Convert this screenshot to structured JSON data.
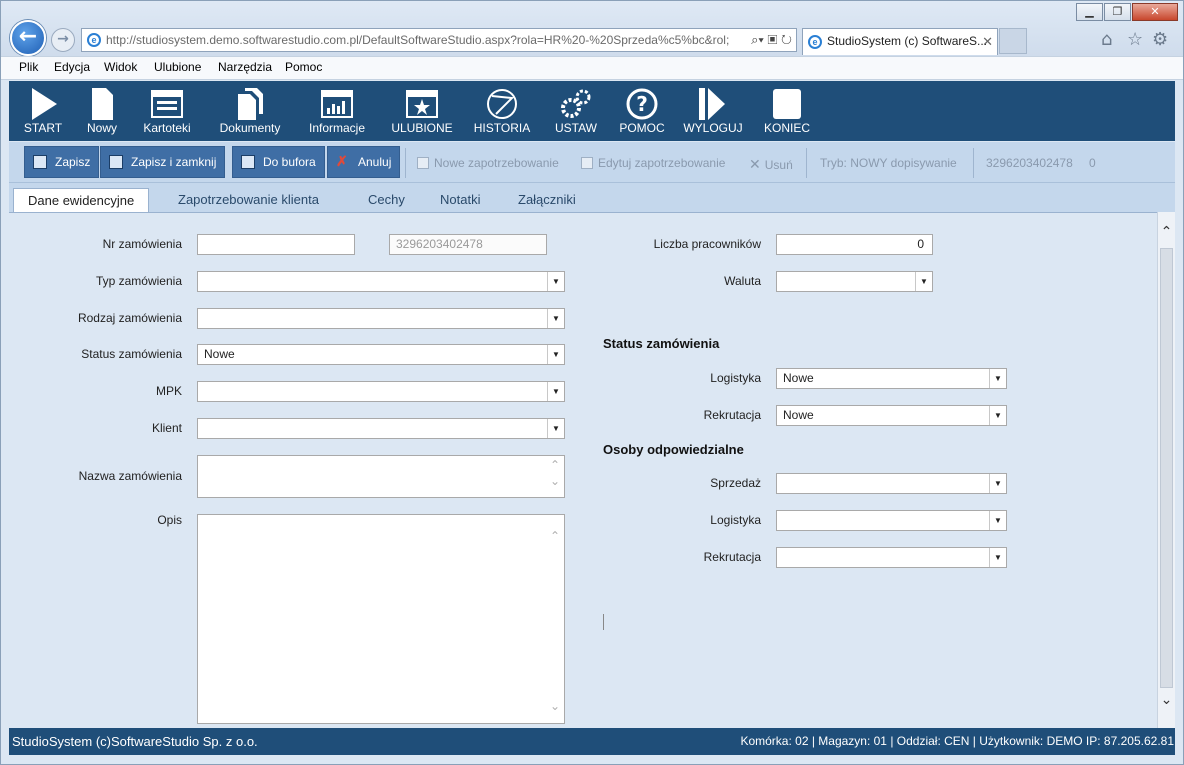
{
  "browser": {
    "url": "http://studiosystem.demo.softwarestudio.com.pl/DefaultSoftwareStudio.aspx?rola=HR%20-%20Sprzeda%c5%bc&rol;",
    "tab_title": "StudioSystem (c) SoftwareS...",
    "menu": [
      "Plik",
      "Edycja",
      "Widok",
      "Ulubione",
      "Narzędzia",
      "Pomoc"
    ]
  },
  "toolbar": {
    "items": [
      "START",
      "Nowy",
      "Kartoteki",
      "Dokumenty",
      "Informacje",
      "ULUBIONE",
      "HISTORIA",
      "USTAW",
      "POMOC",
      "WYLOGUJ",
      "KONIEC"
    ]
  },
  "actions": {
    "save": "Zapisz",
    "save_close": "Zapisz i zamknij",
    "to_buffer": "Do bufora",
    "cancel": "Anuluj",
    "new_req": "Nowe zapotrzebowanie",
    "edit_req": "Edytuj zapotrzebowanie",
    "delete": "Usuń",
    "mode": "Tryb: NOWY dopisywanie",
    "record_id": "3296203402478",
    "counter": "0"
  },
  "tabs": [
    "Dane ewidencyjne",
    "Zapotrzebowanie klienta",
    "Cechy",
    "Notatki",
    "Załączniki"
  ],
  "form": {
    "nr_label": "Nr zamówienia",
    "nr_value": "",
    "nr_generated": "3296203402478",
    "typ_label": "Typ zamówienia",
    "typ_value": "",
    "rodzaj_label": "Rodzaj zamówienia",
    "rodzaj_value": "",
    "status_label": "Status zamówienia",
    "status_value": "Nowe",
    "mpk_label": "MPK",
    "mpk_value": "",
    "klient_label": "Klient",
    "klient_value": "",
    "nazwa_label": "Nazwa zamówienia",
    "opis_label": "Opis",
    "pracownicy_label": "Liczba pracowników",
    "pracownicy_value": "0",
    "waluta_label": "Waluta",
    "waluta_value": "",
    "status_section": "Status zamówienia",
    "logistyka_label": "Logistyka",
    "logistyka_value": "Nowe",
    "rekrutacja_label": "Rekrutacja",
    "rekrutacja_value": "Nowe",
    "osoby_section": "Osoby odpowiedzialne",
    "sprzedaz_label": "Sprzedaż",
    "sprzedaz_value": "",
    "os_logistyka_label": "Logistyka",
    "os_logistyka_value": "",
    "os_rekrutacja_label": "Rekrutacja",
    "os_rekrutacja_value": ""
  },
  "status": {
    "left": "StudioSystem (c)SoftwareStudio Sp. z o.o.",
    "right": "Komórka: 02 | Magazyn: 01 | Oddział: CEN | Użytkownik: DEMO IP: 87.205.62.81"
  },
  "colors": {
    "toolbar_bg": "#1f4e79",
    "action_button": "#3f6ea5",
    "content_bg": "#dce7f3"
  }
}
